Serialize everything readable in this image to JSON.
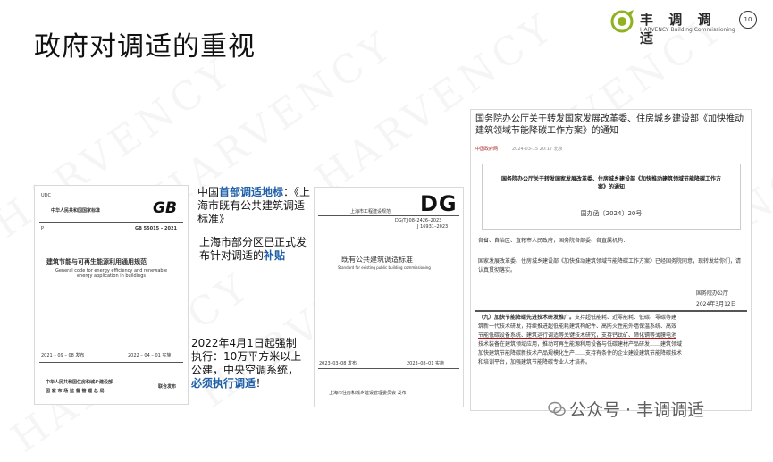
{
  "watermark": "HARVENCY",
  "page_title": "政府对调适的重视",
  "logo": {
    "name": "丰 调 调 适",
    "subtitle": "HARVENCY Building Commissioning",
    "page_number": "10"
  },
  "doc1": {
    "udc": "UDC",
    "header": "中华人民共和国国家标准",
    "code_badge": "GB",
    "p_label": "P",
    "std_number": "GB 55015 – 2021",
    "title_cn": "建筑节能与可再生能源利用通用规范",
    "title_en": "General code for energy efficiency and renewable energy application in buildings",
    "issue_date": "2021 – 09 – 08  发布",
    "effective_date": "2022 – 04 – 01  实施",
    "issuer_1": "中华人民共和国住房和城乡建设部",
    "issuer_2": "国 家 市 场 监 督 管 理 总 局",
    "issuer_joint": "联合发布"
  },
  "doc2": {
    "logo": "DG",
    "header": "上海市工程建设规范",
    "std_number": "DG/TJ 08–2426–2023",
    "std_number2": "J 16931–2023",
    "title_cn": "既有公共建筑调适标准",
    "title_en": "Standard for existing public building commissioning",
    "issue_date": "2023–03–08  发布",
    "effective_date": "2023–08–01  实施",
    "issuer": "上海市住房和城乡建设管理委员会  发布"
  },
  "doc3": {
    "headline": "国务院办公厅关于转发国家发展改革委、住房城乡建设部《加快推动建筑领域节能降碳工作方案》的通知",
    "source": "中国政府网",
    "datetime": "2024-03-15 20:17  北京",
    "box_title": "国务院办公厅关于转发国家发展改革委、住房城乡建设部《加快推动建筑领域节能降碳工作方案》的通知",
    "doc_number": "国办函〔2024〕20号",
    "recipients": "各省、自治区、直辖市人民政府，国务院各部委、各直属机构：",
    "body": "国家发展改革委、住房城乡建设部《加快推动建筑领域节能降碳工作方案》已经国务院同意，现转发给你们，请认真贯彻落实。",
    "signature": "国务院办公厅",
    "date": "2024年3月12日",
    "section_title": "（九）加快节能降碳先进技术研发推广。",
    "section_lines": [
      "支持超低能耗、近零能耗、低碳、零碳等建",
      "筑新一代技术研发，持续推进超低能耗建筑构配件、高防火性能外墙保温系统、高效",
      "节能低碳设备系统、建筑运行调适等关键技术研究，支持钙钛矿、碲化镉等薄膜电池",
      "技术装备在建筑领域应用，推动可再生能源利用设备与低碳建材产品研发……建筑领域",
      "加快建筑节能降碳新技术产品规模化生产……支持有条件的企业建设建筑节能降碳技术",
      "和培训平台，加强建筑节能降碳专业人才培养。"
    ]
  },
  "annotation_top": {
    "prefix": "中国",
    "highlight": "首部调适地标",
    "suffix": "：《上海市既有公共建筑调适标准》"
  },
  "annotation_mid": {
    "text": "上海市部分区已正式发布针对调适的",
    "highlight": "补贴"
  },
  "annotation_bottom": {
    "text": "2022年4月1日起强制执行：10万平方米以上公建，中央空调系统，",
    "highlight": "必须执行调适",
    "suffix": "！"
  },
  "wechat_watermark": "公众号 · 丰调调适"
}
